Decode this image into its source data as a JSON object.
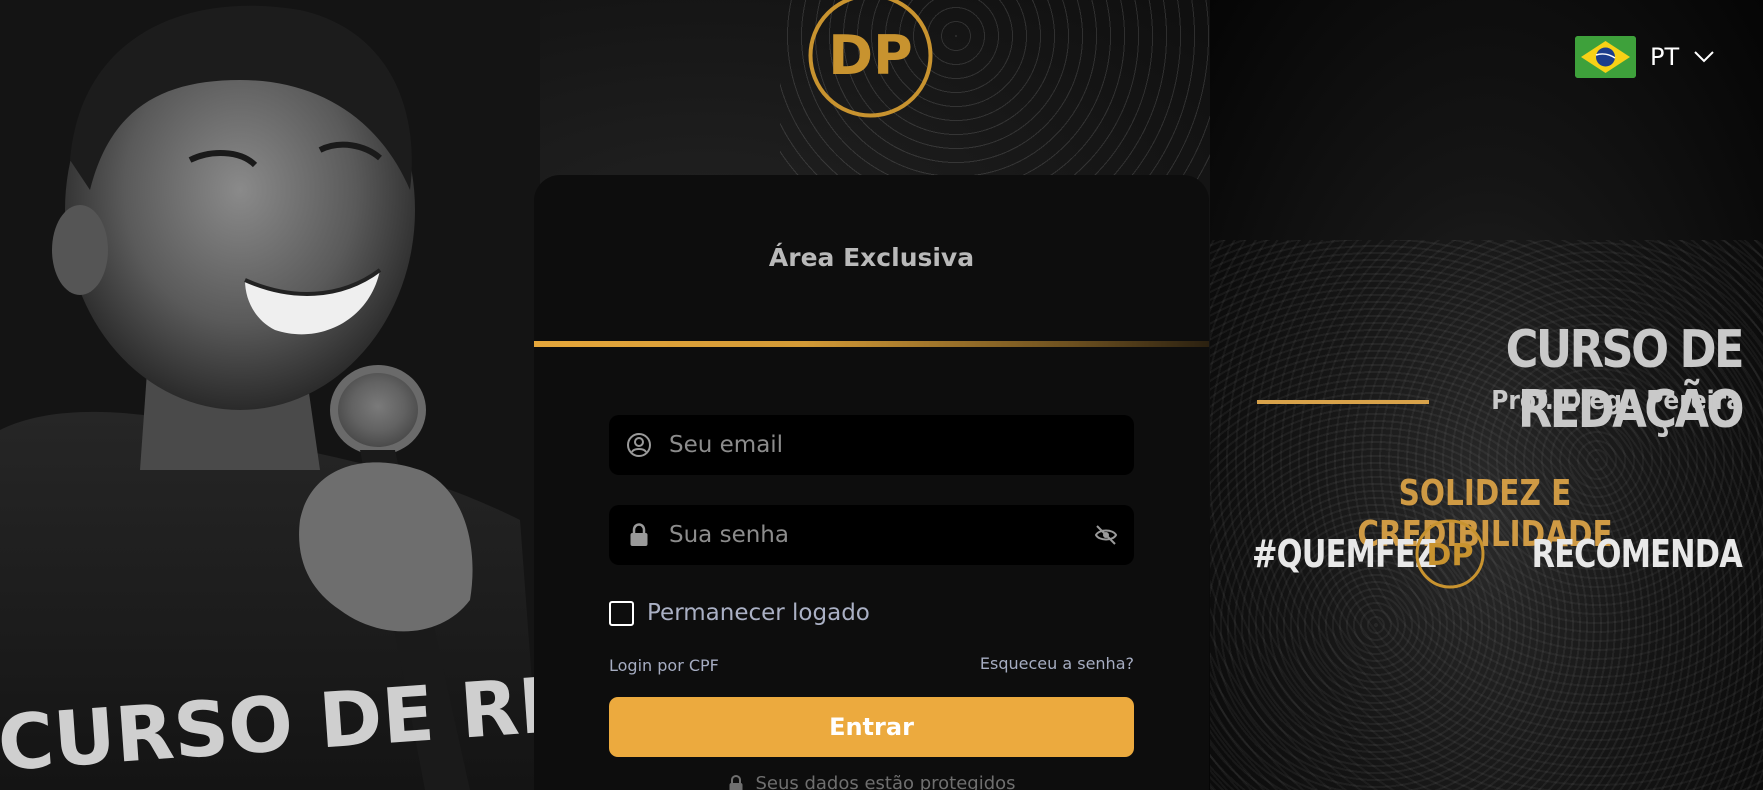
{
  "brand": {
    "logo_text": "DP",
    "accent_color": "#ecaa3e",
    "gold_color": "#c8932f"
  },
  "language": {
    "code": "PT",
    "flag_icon": "brazil-flag-icon"
  },
  "login_card": {
    "title": "Área Exclusiva",
    "email": {
      "placeholder": "Seu email",
      "value": "",
      "icon": "user-circle-icon"
    },
    "password": {
      "placeholder": "Sua senha",
      "value": "",
      "icon": "lock-icon",
      "toggle_icon": "eye-off-icon"
    },
    "remember_me": {
      "label": "Permanecer logado",
      "checked": false
    },
    "login_cpf_link": "Login por CPF",
    "forgot_password_link": "Esqueceu a senha?",
    "submit_label": "Entrar",
    "secure_text": "Seus dados estão protegidos"
  },
  "promo": {
    "title": "CURSO DE REDAÇÃO",
    "subtitle": "Prof. Diego Pereira",
    "tagline": "SOLIDEZ E CREDIBILIDADE",
    "hashtag_left": "#QUEMFEZ",
    "hashtag_right": "RECOMENDA",
    "shirt_text": "CURSO DE REDA"
  }
}
